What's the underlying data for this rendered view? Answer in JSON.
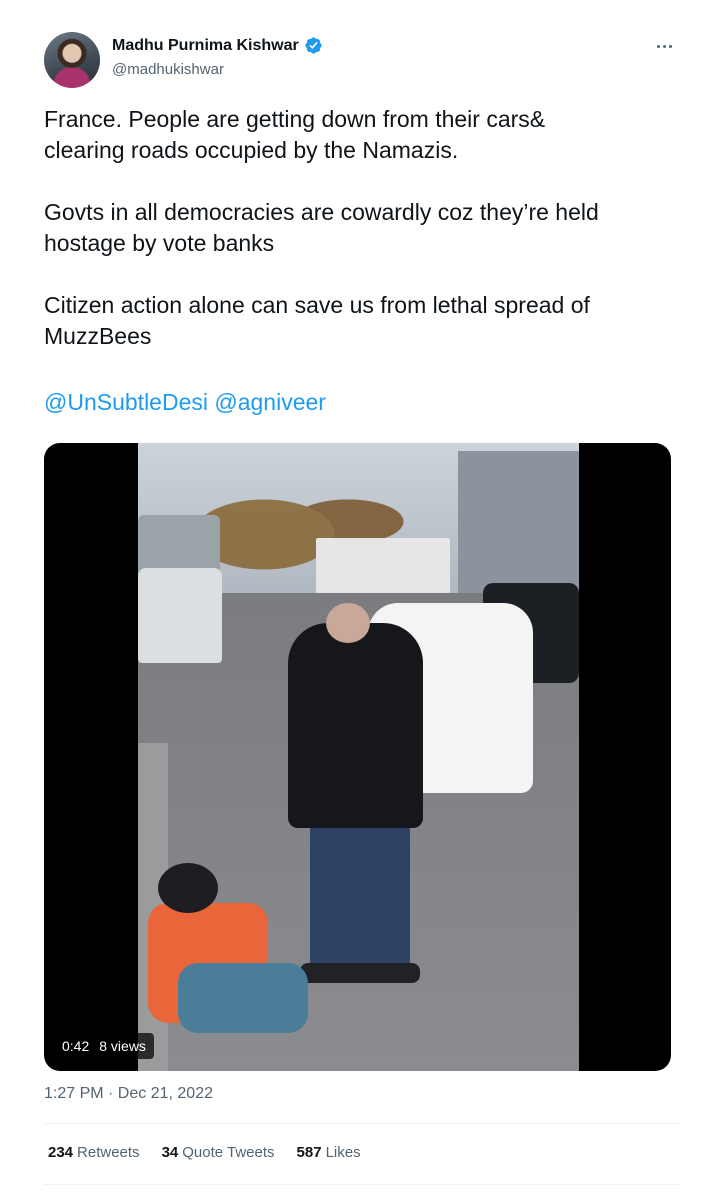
{
  "author": {
    "display_name": "Madhu Purnima Kishwar",
    "handle": "@madhukishwar",
    "verified": true,
    "avatar_icon": "profile-photo"
  },
  "tweet": {
    "paragraphs": [
      "France. People are getting down from their cars&\nclearing roads occupied by the Namazis.",
      "Govts in all democracies are cowardly coz they’re held\nhostage by vote banks",
      "Citizen action alone can save us from lethal spread of\nMuzzBees"
    ],
    "mentions": [
      "@UnSubtleDesi",
      "@agniveer"
    ]
  },
  "media": {
    "duration": "0:42",
    "views": "8 views"
  },
  "timestamp": "1:27 PM · Dec 21, 2022",
  "stats": [
    {
      "count": "234",
      "label": "Retweets"
    },
    {
      "count": "34",
      "label": "Quote Tweets"
    },
    {
      "count": "587",
      "label": "Likes"
    }
  ],
  "colors": {
    "accent": "#1d9bf0",
    "secondary_text": "#536471",
    "primary_text": "#0f1419"
  }
}
